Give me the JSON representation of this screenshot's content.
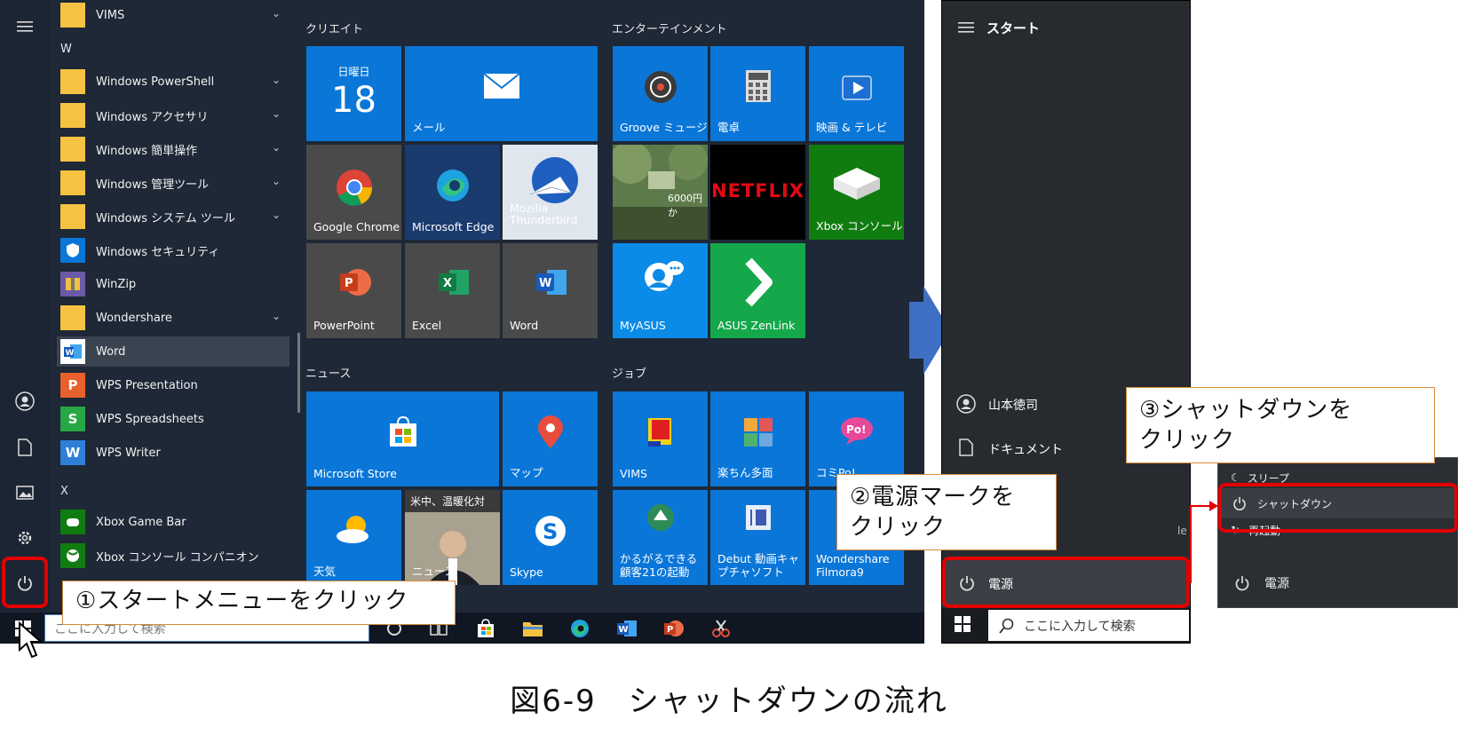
{
  "left_menu": {
    "rail_icons": [
      "hamburger-icon",
      "user-icon",
      "document-icon",
      "pictures-icon",
      "settings-icon",
      "power-icon"
    ],
    "sections": [
      {
        "type": "app",
        "label": "VIMS",
        "icon": "folder",
        "chevron": true
      },
      {
        "type": "letter",
        "label": "W"
      },
      {
        "type": "app",
        "label": "Windows PowerShell",
        "icon": "folder",
        "chevron": true
      },
      {
        "type": "app",
        "label": "Windows アクセサリ",
        "icon": "folder",
        "chevron": true
      },
      {
        "type": "app",
        "label": "Windows 簡単操作",
        "icon": "folder",
        "chevron": true
      },
      {
        "type": "app",
        "label": "Windows 管理ツール",
        "icon": "folder",
        "chevron": true
      },
      {
        "type": "app",
        "label": "Windows システム ツール",
        "icon": "folder",
        "chevron": true
      },
      {
        "type": "app",
        "label": "Windows セキュリティ",
        "icon": "shield",
        "chevron": false
      },
      {
        "type": "app",
        "label": "WinZip",
        "icon": "winzip",
        "chevron": false
      },
      {
        "type": "app",
        "label": "Wondershare",
        "icon": "folder",
        "chevron": true
      },
      {
        "type": "app",
        "label": "Word",
        "icon": "word",
        "chevron": false,
        "selected": true
      },
      {
        "type": "app",
        "label": "WPS Presentation",
        "icon": "wps-p",
        "chevron": false
      },
      {
        "type": "app",
        "label": "WPS Spreadsheets",
        "icon": "wps-s",
        "chevron": false
      },
      {
        "type": "app",
        "label": "WPS Writer",
        "icon": "wps-w",
        "chevron": false
      },
      {
        "type": "letter",
        "label": "X"
      },
      {
        "type": "app",
        "label": "Xbox Game Bar",
        "icon": "xbox-bar",
        "chevron": false
      },
      {
        "type": "app",
        "label": "Xbox コンソール コンパニオン",
        "icon": "xbox",
        "chevron": false
      }
    ]
  },
  "tile_groups": {
    "create": "クリエイト",
    "entertainment": "エンターテインメント",
    "news": "ニュース",
    "jobs": "ジョブ"
  },
  "tiles": {
    "calendar_day": "日曜日",
    "calendar_date": "18",
    "mail": "メール",
    "chrome": "Google Chrome",
    "edge": "Microsoft Edge",
    "thunderbird": "Mozilla Thunderbird",
    "powerpoint": "PowerPoint",
    "excel": "Excel",
    "word": "Word",
    "groove": "Groove ミュージ...",
    "calculator": "電卓",
    "movies": "映画 & テレビ",
    "photo_price": "6000円か",
    "netflix": "NETFLIX",
    "xbox": "Xbox コンソール...",
    "myasus": "MyASUS",
    "zenlink": "ASUS ZenLink",
    "store": "Microsoft Store",
    "maps": "マップ",
    "weather": "天気",
    "news_headline": "米中、温暖化対",
    "news_label": "ニュース",
    "skype": "Skype",
    "vims": "VIMS",
    "rakuchin": "楽ちん多面",
    "komipo": "コミPo!",
    "karugaru": "かるがるできる顧客21の起動",
    "debut": "Debut 動画キャプチャソフト",
    "filmora": "Wondershare Filmora9"
  },
  "taskbar1": {
    "search_placeholder": "ここに入力して検索"
  },
  "panel2": {
    "title": "スタート",
    "user": "山本徳司",
    "documents": "ドキュメント",
    "power": "電源",
    "search_placeholder": "ここに入力して検索",
    "edge_letter": "le"
  },
  "panel3": {
    "sleep": "スリープ",
    "shutdown": "シャットダウン",
    "restart": "再起動",
    "power": "電源"
  },
  "callouts": {
    "step1": "①スタートメニューをクリック",
    "step2_line1": "②電源マークを",
    "step2_line2": "クリック",
    "step3_line1": "③シャットダウンを",
    "step3_line2": "クリック"
  },
  "caption": "図6-9　シャットダウンの流れ",
  "colors": {
    "tile_blue": "#0a76d8",
    "highlight_red": "#e30000",
    "callout_border": "#d88b3e",
    "arrow_blue": "#3f6fc4"
  }
}
